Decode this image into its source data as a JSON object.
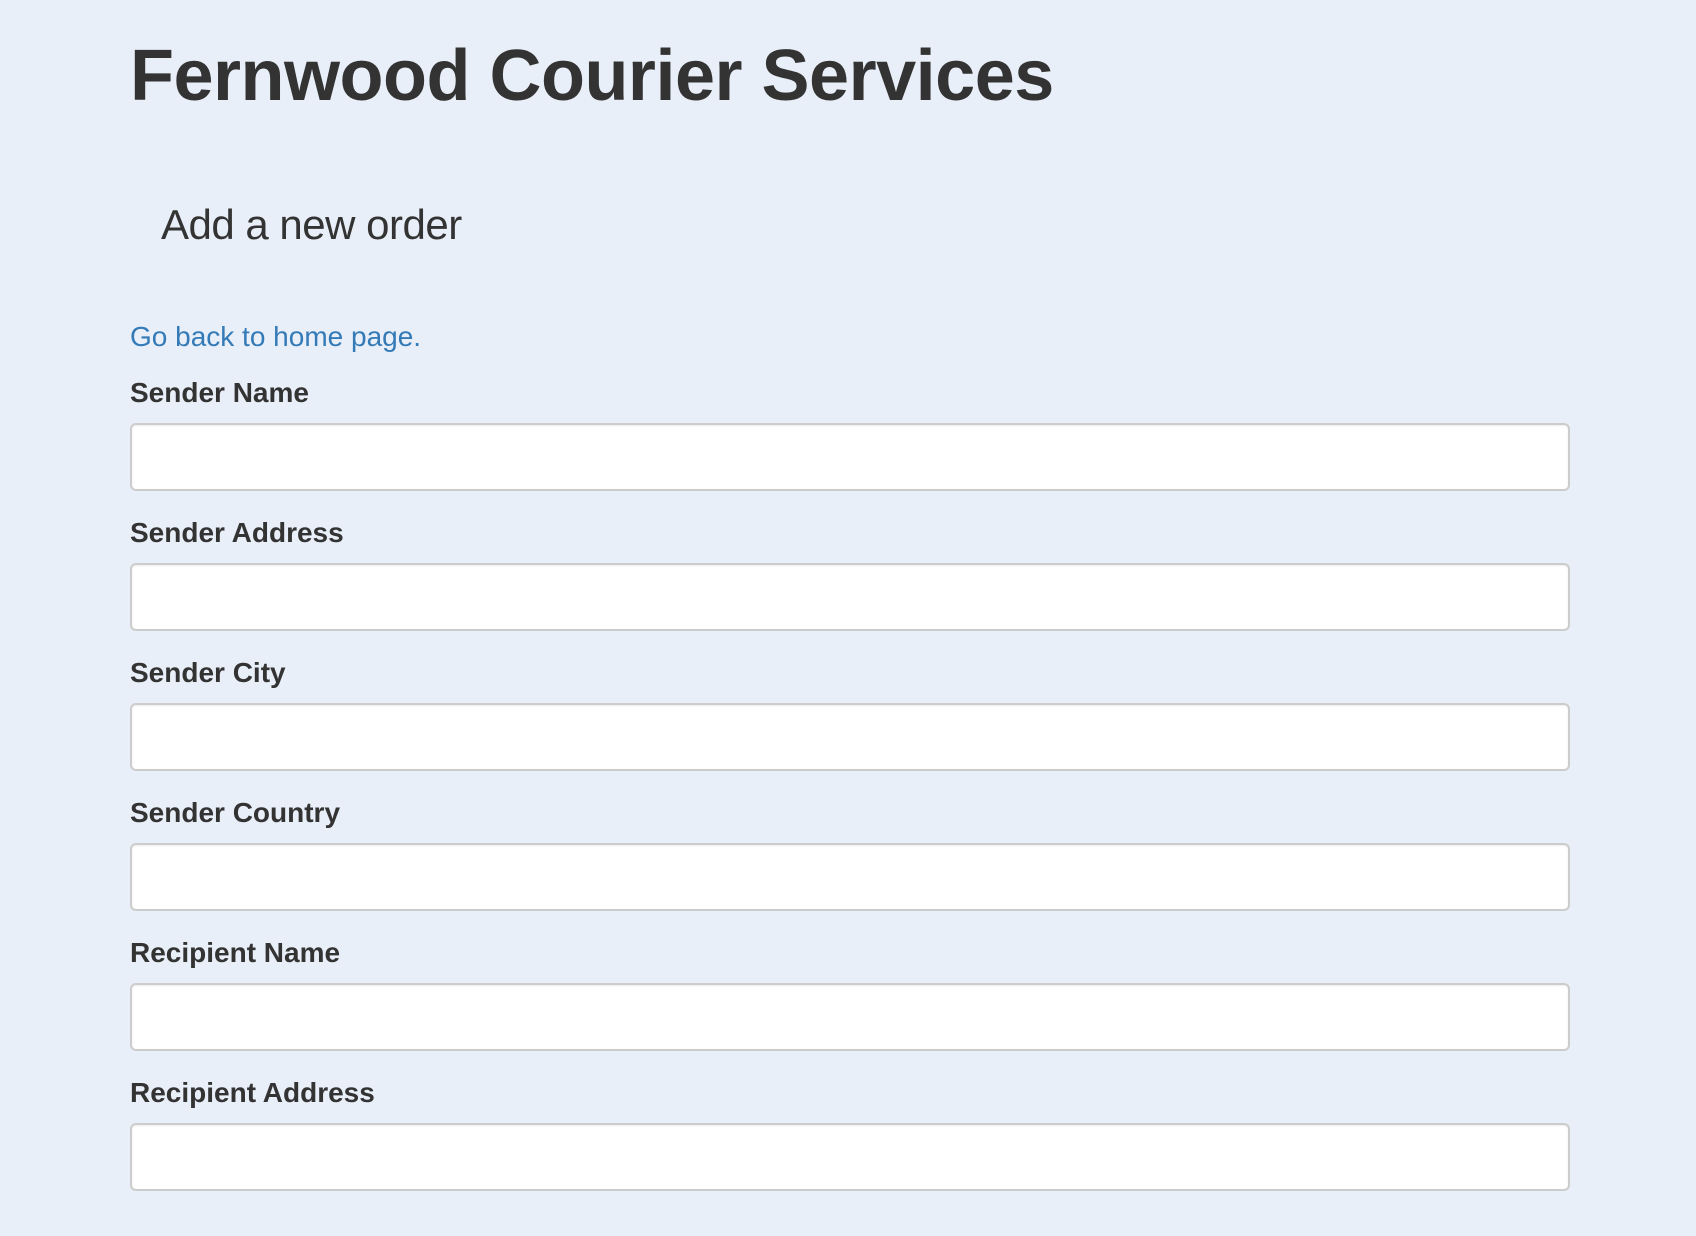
{
  "header": {
    "site_title": "Fernwood Courier Services",
    "page_subtitle": "Add a new order"
  },
  "nav": {
    "back_link": "Go back to home page."
  },
  "form": {
    "fields": [
      {
        "label": "Sender Name",
        "value": "",
        "placeholder": ""
      },
      {
        "label": "Sender Address",
        "value": "",
        "placeholder": ""
      },
      {
        "label": "Sender City",
        "value": "",
        "placeholder": ""
      },
      {
        "label": "Sender Country",
        "value": "",
        "placeholder": ""
      },
      {
        "label": "Recipient Name",
        "value": "",
        "placeholder": ""
      },
      {
        "label": "Recipient Address",
        "value": "",
        "placeholder": ""
      }
    ]
  },
  "colors": {
    "background": "#e9eff8",
    "text": "#333333",
    "link": "#337ab7",
    "input_border": "#cccccc"
  }
}
